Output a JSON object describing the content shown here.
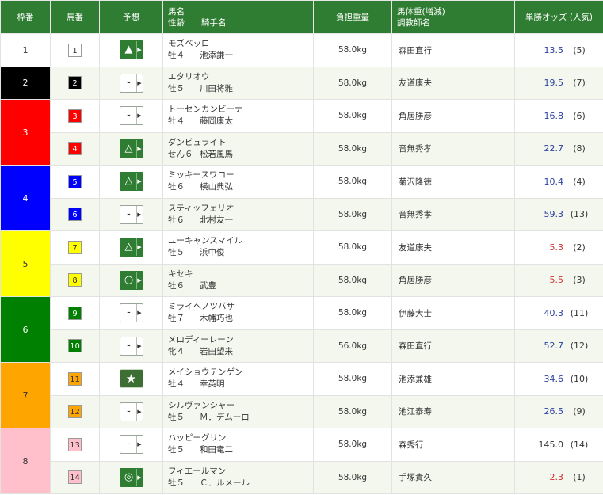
{
  "header": {
    "waku": "枠番",
    "umaban": "馬番",
    "yoso": "予想",
    "horse_line1": "馬名",
    "horse_line2": "性齢　　騎手名",
    "weight": "負担重量",
    "trainer_line1": "馬体重(増減)",
    "trainer_line2": "調教師名",
    "odds": "単勝オッズ (人気)"
  },
  "colors": {
    "header_green": "#2f7d32",
    "odds_blue": "#2b3fa0",
    "odds_red": "#d32f2f",
    "waku1": "#ffffff",
    "waku2": "#000000",
    "waku3": "#ff0000",
    "waku4": "#0000ff",
    "waku5": "#ffff00",
    "waku6": "#008000",
    "waku7": "#ffa500",
    "waku8": "#ffc0cb"
  },
  "rows": [
    {
      "waku": "1",
      "waku_span": 1,
      "waku_color": "#ffffff",
      "waku_text": "#333333",
      "umaban": "1",
      "box_bg": "#ffffff",
      "box_fg": "#333333",
      "pred": "▲",
      "pred_on": true,
      "name": "モズベッロ",
      "sexage": "牡４",
      "jockey": "池添謙一",
      "weight": "58.0kg",
      "trainer": "森田直行",
      "odds": "13.5",
      "odds_color": "#2b3fa0",
      "pop": "(5)"
    },
    {
      "waku": "2",
      "waku_span": 1,
      "waku_color": "#000000",
      "waku_text": "#ffffff",
      "umaban": "2",
      "box_bg": "#000000",
      "box_fg": "#ffffff",
      "pred": "-",
      "pred_on": false,
      "name": "エタリオウ",
      "sexage": "牡５",
      "jockey": "川田将雅",
      "weight": "58.0kg",
      "trainer": "友道康夫",
      "odds": "19.5",
      "odds_color": "#2b3fa0",
      "pop": "(7)"
    },
    {
      "waku": "3",
      "waku_span": 2,
      "waku_color": "#ff0000",
      "waku_text": "#ffffff",
      "umaban": "3",
      "box_bg": "#ff0000",
      "box_fg": "#ffffff",
      "pred": "-",
      "pred_on": false,
      "name": "トーセンカンビーナ",
      "sexage": "牡４",
      "jockey": "藤岡康太",
      "weight": "58.0kg",
      "trainer": "角居勝彦",
      "odds": "16.8",
      "odds_color": "#2b3fa0",
      "pop": "(6)"
    },
    {
      "waku": "",
      "waku_span": 0,
      "waku_color": "",
      "waku_text": "",
      "umaban": "4",
      "box_bg": "#ff0000",
      "box_fg": "#ffffff",
      "pred": "△",
      "pred_on": true,
      "name": "ダンビュライト",
      "sexage": "せん６",
      "jockey": "松若風馬",
      "weight": "58.0kg",
      "trainer": "音無秀孝",
      "odds": "22.7",
      "odds_color": "#2b3fa0",
      "pop": "(8)"
    },
    {
      "waku": "4",
      "waku_span": 2,
      "waku_color": "#0000ff",
      "waku_text": "#ffffff",
      "umaban": "5",
      "box_bg": "#0000ff",
      "box_fg": "#ffffff",
      "pred": "△",
      "pred_on": true,
      "name": "ミッキースワロー",
      "sexage": "牡６",
      "jockey": "横山典弘",
      "weight": "58.0kg",
      "trainer": "菊沢隆徳",
      "odds": "10.4",
      "odds_color": "#2b3fa0",
      "pop": "(4)"
    },
    {
      "waku": "",
      "waku_span": 0,
      "waku_color": "",
      "waku_text": "",
      "umaban": "6",
      "box_bg": "#0000ff",
      "box_fg": "#ffffff",
      "pred": "-",
      "pred_on": false,
      "name": "スティッフェリオ",
      "sexage": "牡６",
      "jockey": "北村友一",
      "weight": "58.0kg",
      "trainer": "音無秀孝",
      "odds": "59.3",
      "odds_color": "#2b3fa0",
      "pop": "(13)"
    },
    {
      "waku": "5",
      "waku_span": 2,
      "waku_color": "#ffff00",
      "waku_text": "#333333",
      "umaban": "7",
      "box_bg": "#ffff00",
      "box_fg": "#333333",
      "pred": "△",
      "pred_on": true,
      "name": "ユーキャンスマイル",
      "sexage": "牡５",
      "jockey": "浜中俊",
      "weight": "58.0kg",
      "trainer": "友道康夫",
      "odds": "5.3",
      "odds_color": "#d32f2f",
      "pop": "(2)"
    },
    {
      "waku": "",
      "waku_span": 0,
      "waku_color": "",
      "waku_text": "",
      "umaban": "8",
      "box_bg": "#ffff00",
      "box_fg": "#333333",
      "pred": "○",
      "pred_on": true,
      "name": "キセキ",
      "sexage": "牡６",
      "jockey": "武豊",
      "weight": "58.0kg",
      "trainer": "角居勝彦",
      "odds": "5.5",
      "odds_color": "#d32f2f",
      "pop": "(3)"
    },
    {
      "waku": "6",
      "waku_span": 2,
      "waku_color": "#008000",
      "waku_text": "#ffffff",
      "umaban": "9",
      "box_bg": "#008000",
      "box_fg": "#ffffff",
      "pred": "-",
      "pred_on": false,
      "name": "ミライヘノツバサ",
      "sexage": "牡７",
      "jockey": "木幡巧也",
      "weight": "58.0kg",
      "trainer": "伊藤大士",
      "odds": "40.3",
      "odds_color": "#2b3fa0",
      "pop": "(11)"
    },
    {
      "waku": "",
      "waku_span": 0,
      "waku_color": "",
      "waku_text": "",
      "umaban": "10",
      "box_bg": "#008000",
      "box_fg": "#ffffff",
      "pred": "-",
      "pred_on": false,
      "name": "メロディーレーン",
      "sexage": "牝４",
      "jockey": "岩田望来",
      "weight": "56.0kg",
      "trainer": "森田直行",
      "odds": "52.7",
      "odds_color": "#2b3fa0",
      "pop": "(12)"
    },
    {
      "waku": "7",
      "waku_span": 2,
      "waku_color": "#ffa500",
      "waku_text": "#333333",
      "umaban": "11",
      "box_bg": "#ffa500",
      "box_fg": "#333333",
      "pred": "★",
      "pred_on": true,
      "pred_star": true,
      "name": "メイショウテンゲン",
      "sexage": "牡４",
      "jockey": "幸英明",
      "weight": "58.0kg",
      "trainer": "池添兼雄",
      "odds": "34.6",
      "odds_color": "#2b3fa0",
      "pop": "(10)"
    },
    {
      "waku": "",
      "waku_span": 0,
      "waku_color": "",
      "waku_text": "",
      "umaban": "12",
      "box_bg": "#ffa500",
      "box_fg": "#333333",
      "pred": "-",
      "pred_on": false,
      "name": "シルヴァンシャー",
      "sexage": "牡５",
      "jockey": "Ｍ．デムーロ",
      "weight": "58.0kg",
      "trainer": "池江泰寿",
      "odds": "26.5",
      "odds_color": "#2b3fa0",
      "pop": "(9)"
    },
    {
      "waku": "8",
      "waku_span": 2,
      "waku_color": "#ffc0cb",
      "waku_text": "#333333",
      "umaban": "13",
      "box_bg": "#ffc0cb",
      "box_fg": "#333333",
      "pred": "-",
      "pred_on": false,
      "name": "ハッピーグリン",
      "sexage": "牡５",
      "jockey": "和田竜二",
      "weight": "58.0kg",
      "trainer": "森秀行",
      "odds": "145.0",
      "odds_color": "#333333",
      "pop": "(14)"
    },
    {
      "waku": "",
      "waku_span": 0,
      "waku_color": "",
      "waku_text": "",
      "umaban": "14",
      "box_bg": "#ffc0cb",
      "box_fg": "#333333",
      "pred": "◎",
      "pred_on": true,
      "name": "フィエールマン",
      "sexage": "牡５",
      "jockey": "Ｃ．ルメール",
      "weight": "58.0kg",
      "trainer": "手塚貴久",
      "odds": "2.3",
      "odds_color": "#d32f2f",
      "pop": "(1)"
    }
  ]
}
